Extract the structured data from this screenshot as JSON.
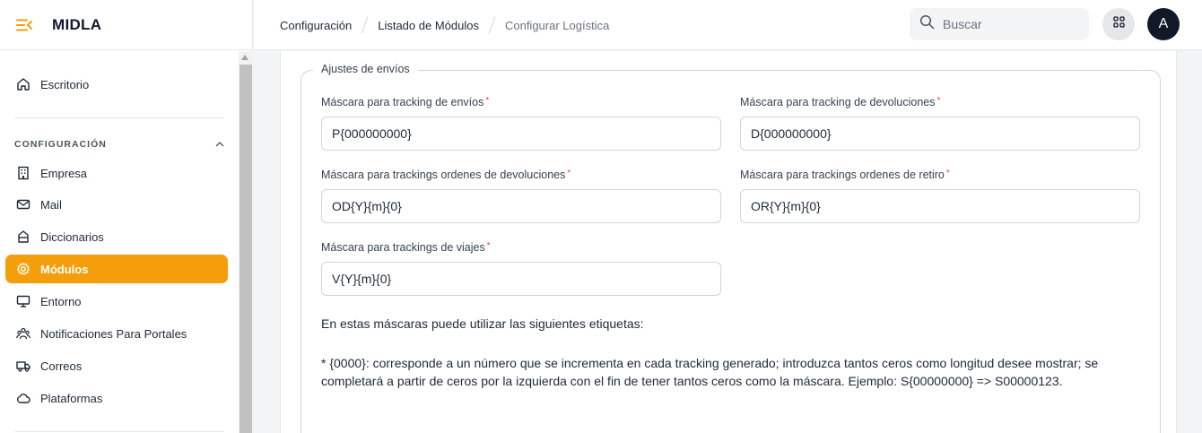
{
  "app": {
    "name": "MIDLA"
  },
  "sidebar": {
    "items": [
      {
        "label": "Escritorio",
        "icon": "home-icon"
      }
    ],
    "section_title": "CONFIGURACIÓN",
    "section_items": [
      {
        "label": "Empresa",
        "icon": "building-icon"
      },
      {
        "label": "Mail",
        "icon": "mail-icon"
      },
      {
        "label": "Diccionarios",
        "icon": "book-icon"
      },
      {
        "label": "Módulos",
        "icon": "gear-icon",
        "active": true
      },
      {
        "label": "Entorno",
        "icon": "monitor-icon"
      },
      {
        "label": "Notificaciones Para Portales",
        "icon": "users-icon"
      },
      {
        "label": "Correos",
        "icon": "truck-icon"
      },
      {
        "label": "Plataformas",
        "icon": "cloud-icon"
      }
    ]
  },
  "header": {
    "breadcrumbs": [
      "Configuración",
      "Listado de Módulos",
      "Configurar Logística"
    ],
    "search_placeholder": "Buscar",
    "avatar_initial": "A"
  },
  "form": {
    "legend": "Ajustes de envíos",
    "fields": [
      {
        "label": "Máscara para tracking de envíos",
        "value": "P{000000000}"
      },
      {
        "label": "Máscara para tracking de devoluciones",
        "value": "D{000000000}"
      },
      {
        "label": "Máscara para trackings ordenes de devoluciones",
        "value": "OD{Y}{m}{0}"
      },
      {
        "label": "Máscara para trackings ordenes de retiro",
        "value": "OR{Y}{m}{0}"
      },
      {
        "label": "Máscara para trackings de viajes",
        "value": "V{Y}{m}{0}"
      }
    ],
    "required_mark": "*",
    "help_intro": "En estas máscaras puede utilizar las siguientes etiquetas:",
    "help_item_1": "* {0000}: corresponde a un número que se incrementa en cada tracking generado; introduzca tantos ceros como longitud desee mostrar; se completará a partir de ceros por la izquierda con el fin de tener tantos ceros como la máscara. Ejemplo: S{00000000} => S00000123."
  },
  "colors": {
    "accent": "#f59e0b",
    "avatar_bg": "#111827"
  }
}
